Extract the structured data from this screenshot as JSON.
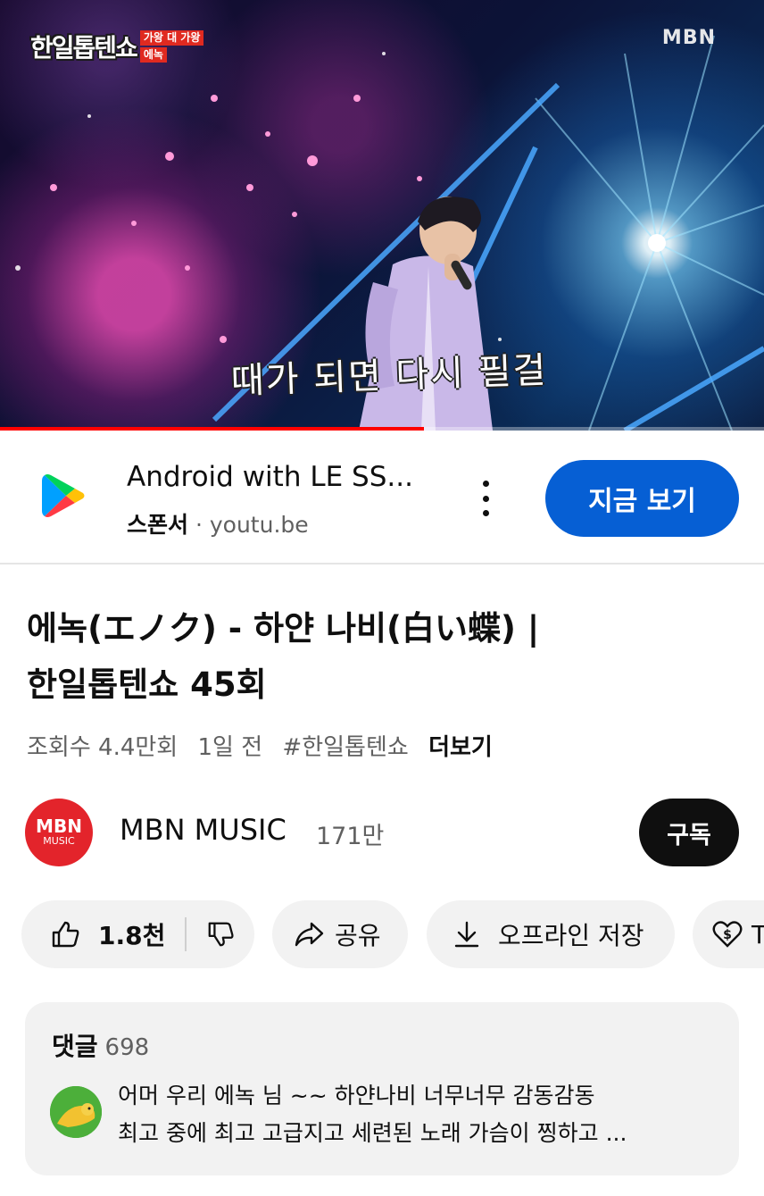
{
  "player": {
    "show_logo": "한일톱텐쇼",
    "show_tag_top": "가왕 대 가왕",
    "show_tag_bottom": "에녹",
    "broadcaster": "MBN",
    "subtitle": "때가 되면 다시 필걸",
    "progress_fraction": 0.555,
    "colors": {
      "progress": "#ff0000"
    }
  },
  "sponsor": {
    "icon": "google-play-icon",
    "title": "Android with LE SS...",
    "label": "스폰서",
    "separator": "·",
    "domain": "youtu.be",
    "cta": "지금 보기",
    "colors": {
      "cta_bg": "#065fd4"
    }
  },
  "video": {
    "title_line1": "에녹(エノク) - 하얀 나비(白い蝶) |",
    "title_line2": "한일톱텐쇼 45회",
    "views": "조회수 4.4만회",
    "age": "1일 전",
    "hashtag": "#한일톱텐쇼",
    "more": "더보기"
  },
  "channel": {
    "avatar_line1": "MBN",
    "avatar_line2": "MUSIC",
    "name": "MBN MUSIC",
    "subscribers": "171만",
    "subscribe": "구독",
    "colors": {
      "avatar_bg": "#e3242b"
    }
  },
  "actions": {
    "likes": "1.8천",
    "share": "공유",
    "save_offline": "오프라인 저장",
    "thanks": "T",
    "icons": [
      "thumbs-up-icon",
      "thumbs-down-icon",
      "share-arrow-icon",
      "download-icon",
      "thanks-heart-icon"
    ]
  },
  "comments": {
    "label": "댓글",
    "count": "698",
    "top_comment_line1": "어머 우리 에녹 님 ~~ 하얀나비 너무너무 감동감동",
    "top_comment_line2": "최고 중에 최고 고급지고 세련된 노래 가슴이 찡하고 ..."
  }
}
